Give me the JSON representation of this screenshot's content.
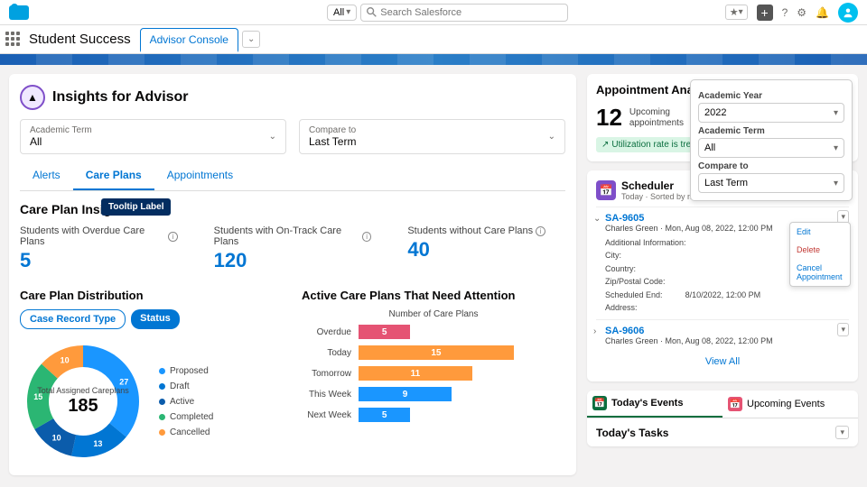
{
  "topbar": {
    "search_scope": "All",
    "search_placeholder": "Search Salesforce"
  },
  "nav": {
    "app_name": "Student Success",
    "tab": "Advisor Console"
  },
  "page": {
    "title": "Insights for Advisor",
    "filter1_label": "Academic Term",
    "filter1_value": "All",
    "filter2_label": "Compare to",
    "filter2_value": "Last Term",
    "tabs": [
      "Alerts",
      "Care Plans",
      "Appointments"
    ],
    "active_tab": 1
  },
  "insights": {
    "title": "Care Plan Insights",
    "tooltip": "Tooltip Label",
    "kpis": [
      {
        "label": "Students with Overdue Care Plans",
        "value": "5"
      },
      {
        "label": "Students with On-Track Care Plans",
        "value": "120"
      },
      {
        "label": "Students without Care Plans",
        "value": "40"
      }
    ]
  },
  "donut": {
    "title": "Care Plan Distribution",
    "pill1": "Case Record Type",
    "pill2": "Status",
    "center_label": "Total Assigned Careplans",
    "center_value": "185",
    "legend": [
      "Proposed",
      "Draft",
      "Active",
      "Completed",
      "Cancelled"
    ]
  },
  "bars": {
    "title": "Active Care Plans That Need Attention",
    "axis": "Number of Care Plans"
  },
  "analysis": {
    "title": "Appointment Analysis",
    "value": "12",
    "sub1": "Upcoming",
    "sub2": "appointments",
    "trend": "Utilization rate is tren",
    "pop_year_label": "Academic Year",
    "pop_year_val": "2022",
    "pop_term_label": "Academic Term",
    "pop_term_val": "All",
    "pop_cmp_label": "Compare to",
    "pop_cmp_val": "Last Term"
  },
  "scheduler": {
    "title": "Scheduler",
    "sub": "Today · Sorted by next",
    "appt1_id": "SA-9605",
    "appt1_sub": "Charles Green · Mon, Aug 08, 2022, 12:00 PM",
    "appt1_info": "Additional Information:",
    "appt1_city": "City:",
    "appt1_country": "Country:",
    "appt1_zip": "Zip/Postal Code:",
    "appt1_end_label": "Scheduled End:",
    "appt1_end_val": "8/10/2022, 12:00 PM",
    "appt1_addr": "Address:",
    "action_edit": "Edit",
    "action_delete": "Delete",
    "action_cancel": "Cancel Appointment",
    "appt2_id": "SA-9606",
    "appt2_sub": "Charles Green · Mon, Aug 08, 2022, 12:00 PM",
    "view_all": "View All"
  },
  "events": {
    "tab1": "Today's Events",
    "tab2": "Upcoming Events",
    "tasks": "Today's Tasks"
  },
  "chart_data": {
    "donut": {
      "type": "pie",
      "title": "Care Plan Distribution",
      "total_label": "Total Assigned Careplans",
      "total": 185,
      "series": [
        {
          "name": "Proposed",
          "value": 27,
          "color": "#1a96ff"
        },
        {
          "name": "Draft",
          "value": 13,
          "color": "#0176d3"
        },
        {
          "name": "Active",
          "value": 10,
          "color": "#0b5cab"
        },
        {
          "name": "Completed",
          "value": 15,
          "color": "#2bb673"
        },
        {
          "name": "Cancelled",
          "value": 10,
          "color": "#ff9a3c"
        }
      ],
      "labels_suffix": "%"
    },
    "bars": {
      "type": "bar",
      "orientation": "horizontal",
      "title": "Active Care Plans That Need Attention",
      "xlabel": "Number of Care Plans",
      "categories": [
        "Overdue",
        "Today",
        "Tomorrow",
        "This Week",
        "Next Week"
      ],
      "values": [
        5,
        15,
        11,
        9,
        5
      ],
      "colors": [
        "#e55373",
        "#ff9a3c",
        "#ff9a3c",
        "#1a96ff",
        "#1a96ff"
      ],
      "xlim": [
        0,
        20
      ]
    }
  }
}
